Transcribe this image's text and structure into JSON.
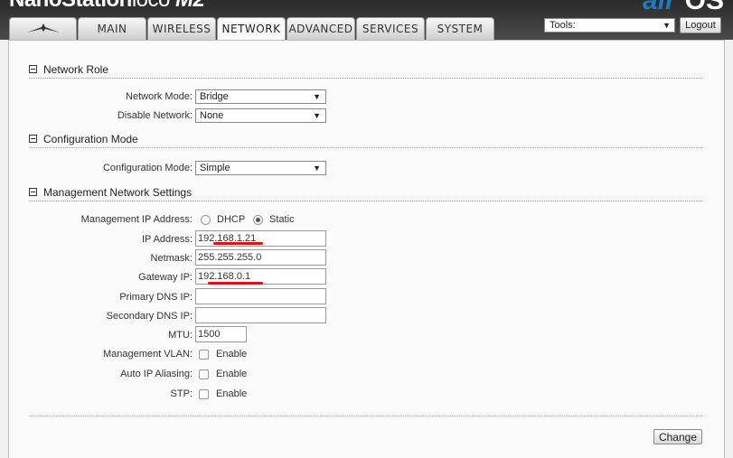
{
  "header": {
    "brand_prefix": "NanoStation",
    "brand_model": "loco",
    "brand_suffix": "M2",
    "airos_prefix": "air",
    "airos_suffix": "OS"
  },
  "tabs": [
    {
      "label": "",
      "icon": "ubiquiti-logo-icon"
    },
    {
      "label": "MAIN"
    },
    {
      "label": "WIRELESS"
    },
    {
      "label": "NETWORK",
      "active": true
    },
    {
      "label": "ADVANCED"
    },
    {
      "label": "SERVICES"
    },
    {
      "label": "SYSTEM"
    }
  ],
  "tools": {
    "selected": "Tools:"
  },
  "logout_label": "Logout",
  "network_role": {
    "title": "Network Role",
    "network_mode_label": "Network Mode:",
    "network_mode_value": "Bridge",
    "disable_network_label": "Disable Network:",
    "disable_network_value": "None"
  },
  "configuration_mode": {
    "title": "Configuration Mode",
    "label": "Configuration Mode:",
    "value": "Simple"
  },
  "management": {
    "title": "Management Network Settings",
    "ip_mode_label": "Management IP Address:",
    "dhcp_label": "DHCP",
    "static_label": "Static",
    "ip_mode_selected": "Static",
    "ip_label": "IP Address:",
    "ip_value": "192.168.1.21",
    "netmask_label": "Netmask:",
    "netmask_value": "255.255.255.0",
    "gateway_label": "Gateway IP:",
    "gateway_value": "192.168.0.1",
    "primary_dns_label": "Primary DNS IP:",
    "primary_dns_value": "",
    "secondary_dns_label": "Secondary DNS IP:",
    "secondary_dns_value": "",
    "mtu_label": "MTU:",
    "mtu_value": "1500",
    "vlan_label": "Management VLAN:",
    "alias_label": "Auto IP Aliasing:",
    "stp_label": "STP:",
    "enable_label": "Enable"
  },
  "colors": {
    "annotation_underline": "#d8141b",
    "airos_blue": "#1e7bc2"
  },
  "change_label": "Change"
}
